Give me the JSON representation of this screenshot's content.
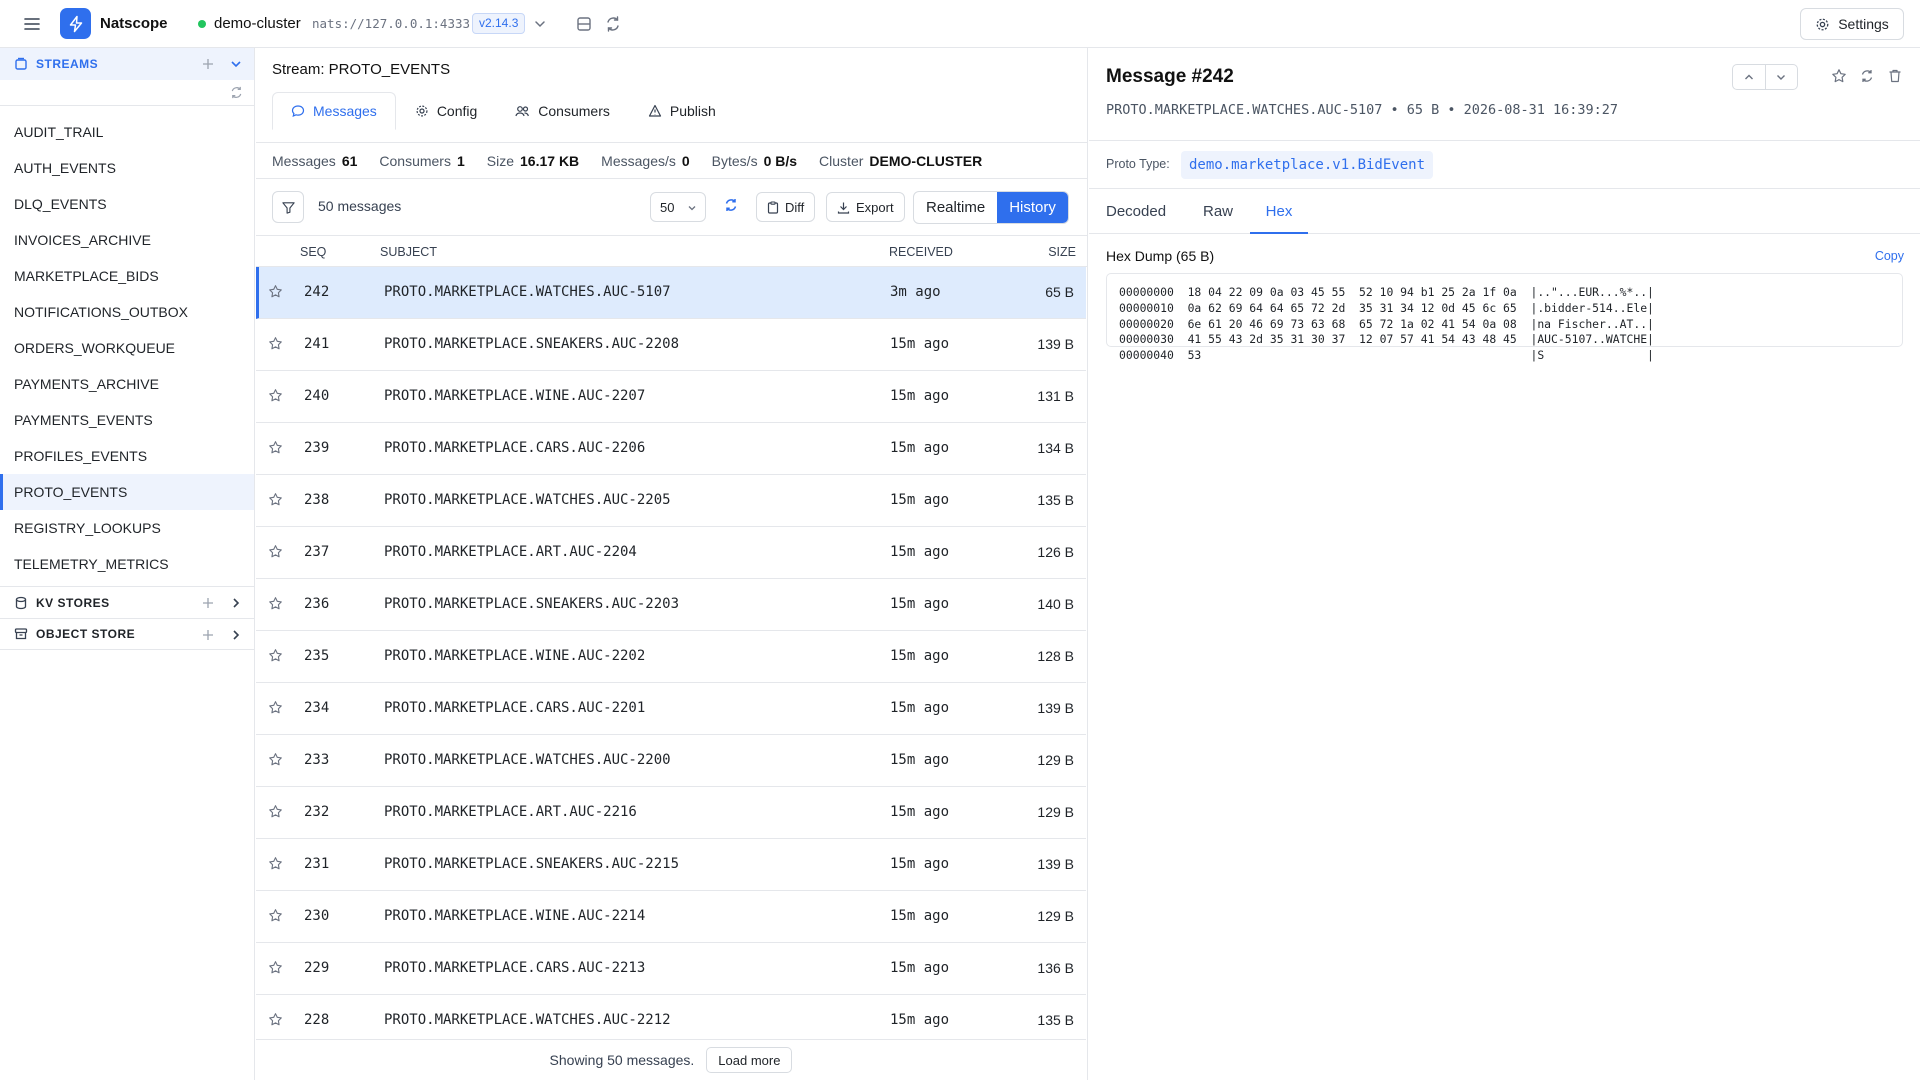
{
  "app": {
    "name": "Natscope"
  },
  "cluster": {
    "name": "demo-cluster",
    "url": "nats://127.0.0.1:4333",
    "version": "v2.14.3",
    "status_color": "#22c55e"
  },
  "header": {
    "settings_label": "Settings"
  },
  "sidebar": {
    "streams_label": "STREAMS",
    "kv_label": "KV STORES",
    "object_label": "OBJECT STORE",
    "streams": [
      "AUDIT_TRAIL",
      "AUTH_EVENTS",
      "DLQ_EVENTS",
      "INVOICES_ARCHIVE",
      "MARKETPLACE_BIDS",
      "NOTIFICATIONS_OUTBOX",
      "ORDERS_WORKQUEUE",
      "PAYMENTS_ARCHIVE",
      "PAYMENTS_EVENTS",
      "PROFILES_EVENTS",
      "PROTO_EVENTS",
      "REGISTRY_LOOKUPS",
      "TELEMETRY_METRICS"
    ],
    "active_stream": "PROTO_EVENTS"
  },
  "stream": {
    "title": "Stream: PROTO_EVENTS",
    "tabs": [
      "Messages",
      "Config",
      "Consumers",
      "Publish"
    ],
    "active_tab": "Messages",
    "stats": [
      {
        "label": "Messages",
        "value": "61"
      },
      {
        "label": "Consumers",
        "value": "1"
      },
      {
        "label": "Size",
        "value": "16.17 KB"
      },
      {
        "label": "Messages/s",
        "value": "0"
      },
      {
        "label": "Bytes/s",
        "value": "0 B/s"
      },
      {
        "label": "Cluster",
        "value": "DEMO-CLUSTER"
      }
    ]
  },
  "toolbar": {
    "message_count": "50 messages",
    "page_size": "50",
    "diff_label": "Diff",
    "export_label": "Export",
    "realtime_label": "Realtime",
    "history_label": "History",
    "mode": "History"
  },
  "table": {
    "columns": [
      "SEQ",
      "SUBJECT",
      "RECEIVED",
      "SIZE"
    ],
    "rows": [
      {
        "seq": "242",
        "subject": "PROTO.MARKETPLACE.WATCHES.AUC-5107",
        "received": "3m ago",
        "size": "65 B",
        "selected": true
      },
      {
        "seq": "241",
        "subject": "PROTO.MARKETPLACE.SNEAKERS.AUC-2208",
        "received": "15m ago",
        "size": "139 B"
      },
      {
        "seq": "240",
        "subject": "PROTO.MARKETPLACE.WINE.AUC-2207",
        "received": "15m ago",
        "size": "131 B"
      },
      {
        "seq": "239",
        "subject": "PROTO.MARKETPLACE.CARS.AUC-2206",
        "received": "15m ago",
        "size": "134 B"
      },
      {
        "seq": "238",
        "subject": "PROTO.MARKETPLACE.WATCHES.AUC-2205",
        "received": "15m ago",
        "size": "135 B"
      },
      {
        "seq": "237",
        "subject": "PROTO.MARKETPLACE.ART.AUC-2204",
        "received": "15m ago",
        "size": "126 B"
      },
      {
        "seq": "236",
        "subject": "PROTO.MARKETPLACE.SNEAKERS.AUC-2203",
        "received": "15m ago",
        "size": "140 B"
      },
      {
        "seq": "235",
        "subject": "PROTO.MARKETPLACE.WINE.AUC-2202",
        "received": "15m ago",
        "size": "128 B"
      },
      {
        "seq": "234",
        "subject": "PROTO.MARKETPLACE.CARS.AUC-2201",
        "received": "15m ago",
        "size": "139 B"
      },
      {
        "seq": "233",
        "subject": "PROTO.MARKETPLACE.WATCHES.AUC-2200",
        "received": "15m ago",
        "size": "129 B"
      },
      {
        "seq": "232",
        "subject": "PROTO.MARKETPLACE.ART.AUC-2216",
        "received": "15m ago",
        "size": "129 B"
      },
      {
        "seq": "231",
        "subject": "PROTO.MARKETPLACE.SNEAKERS.AUC-2215",
        "received": "15m ago",
        "size": "139 B"
      },
      {
        "seq": "230",
        "subject": "PROTO.MARKETPLACE.WINE.AUC-2214",
        "received": "15m ago",
        "size": "129 B"
      },
      {
        "seq": "229",
        "subject": "PROTO.MARKETPLACE.CARS.AUC-2213",
        "received": "15m ago",
        "size": "136 B"
      },
      {
        "seq": "228",
        "subject": "PROTO.MARKETPLACE.WATCHES.AUC-2212",
        "received": "15m ago",
        "size": "135 B"
      }
    ]
  },
  "footer": {
    "showing": "Showing 50 messages.",
    "load_more": "Load more"
  },
  "detail": {
    "title": "Message #242",
    "meta": "PROTO.MARKETPLACE.WATCHES.AUC-5107 • 65 B • 2026-08-31 16:39:27",
    "proto_label": "Proto Type:",
    "proto_type": "demo.marketplace.v1.BidEvent",
    "tabs": [
      "Decoded",
      "Raw",
      "Hex"
    ],
    "active_tab": "Hex",
    "hex_title": "Hex Dump (65 B)",
    "copy_label": "Copy",
    "hex_lines": [
      "00000000  18 04 22 09 0a 03 45 55  52 10 94 b1 25 2a 1f 0a  |..\"...EUR...%*..|",
      "00000010  0a 62 69 64 64 65 72 2d  35 31 34 12 0d 45 6c 65  |.bidder-514..Ele|",
      "00000020  6e 61 20 46 69 73 63 68  65 72 1a 02 41 54 0a 08  |na Fischer..AT..|",
      "00000030  41 55 43 2d 35 31 30 37  12 07 57 41 54 43 48 45  |AUC-5107..WATCHE|",
      "00000040  53                                                |S               |"
    ]
  },
  "colors": {
    "accent": "#2f6fed",
    "selected_row": "#deebfd",
    "active_nav": "#eef3fd"
  }
}
